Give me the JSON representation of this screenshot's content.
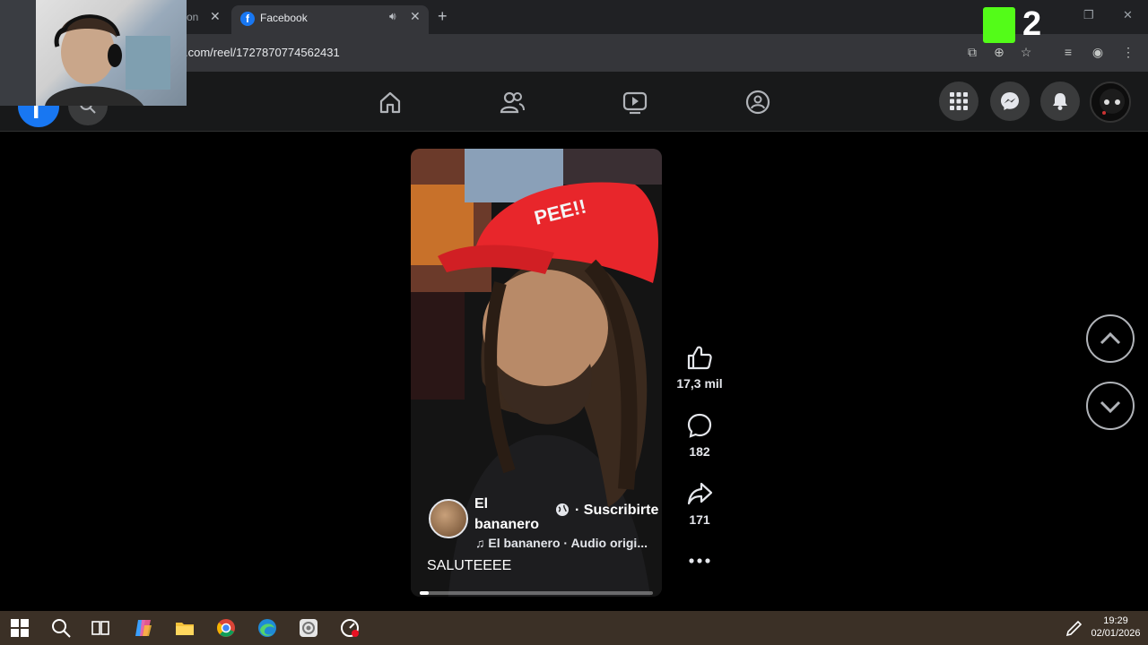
{
  "browser": {
    "inactive_tab_fragment": "on",
    "active_tab_title": "Facebook",
    "url": ".com/reel/1727870774562431"
  },
  "overlay": {
    "k2_number": "2"
  },
  "reel": {
    "author_name": "El bananero",
    "subscribe_label": "· Suscribirte",
    "audio_text": "♫ El bananero · Audio origi...",
    "caption": "SALUTEEEE",
    "progress_fraction": 0.04
  },
  "actions": {
    "likes": "17,3 mil",
    "comments": "182",
    "shares": "171"
  },
  "taskbar": {
    "time": "19:29",
    "date": "02/01/2026"
  },
  "colors": {
    "fb_blue": "#1877f2",
    "cap_red": "#e8262b",
    "kick_green": "#53fc18"
  }
}
